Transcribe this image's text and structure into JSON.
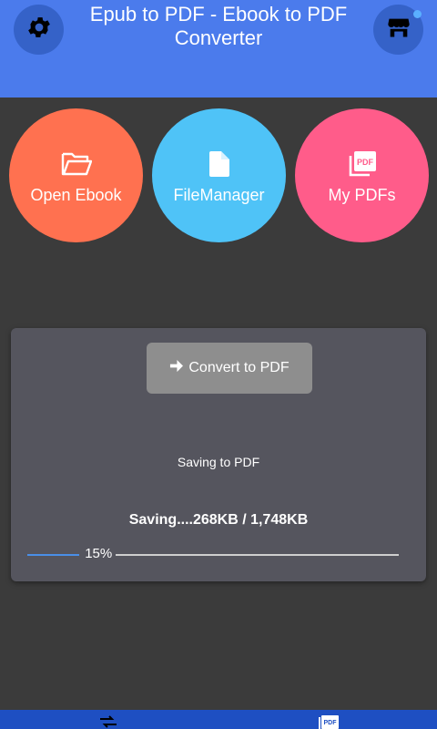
{
  "header": {
    "title": "Epub to PDF - Ebook to PDF Converter",
    "settings_icon": "gear-icon",
    "store_icon": "store-icon"
  },
  "actions": [
    {
      "label": "Open Ebook",
      "icon": "folder-open-icon",
      "color": "#ff7150"
    },
    {
      "label": "FileManager",
      "icon": "file-icon",
      "color": "#4fc3f7"
    },
    {
      "label": "My PDFs",
      "icon": "pdf-files-icon",
      "color": "#ff5c8a"
    }
  ],
  "converter": {
    "button_label": "Convert to PDF",
    "status": "Saving to PDF",
    "progress_text": "Saving....268KB / 1,748KB",
    "progress_percent": "15%",
    "progress_value": 0.15
  },
  "bottom_nav": {
    "items": [
      {
        "icon": "convert-arrows-icon"
      },
      {
        "icon": "pdf-icon"
      }
    ]
  }
}
